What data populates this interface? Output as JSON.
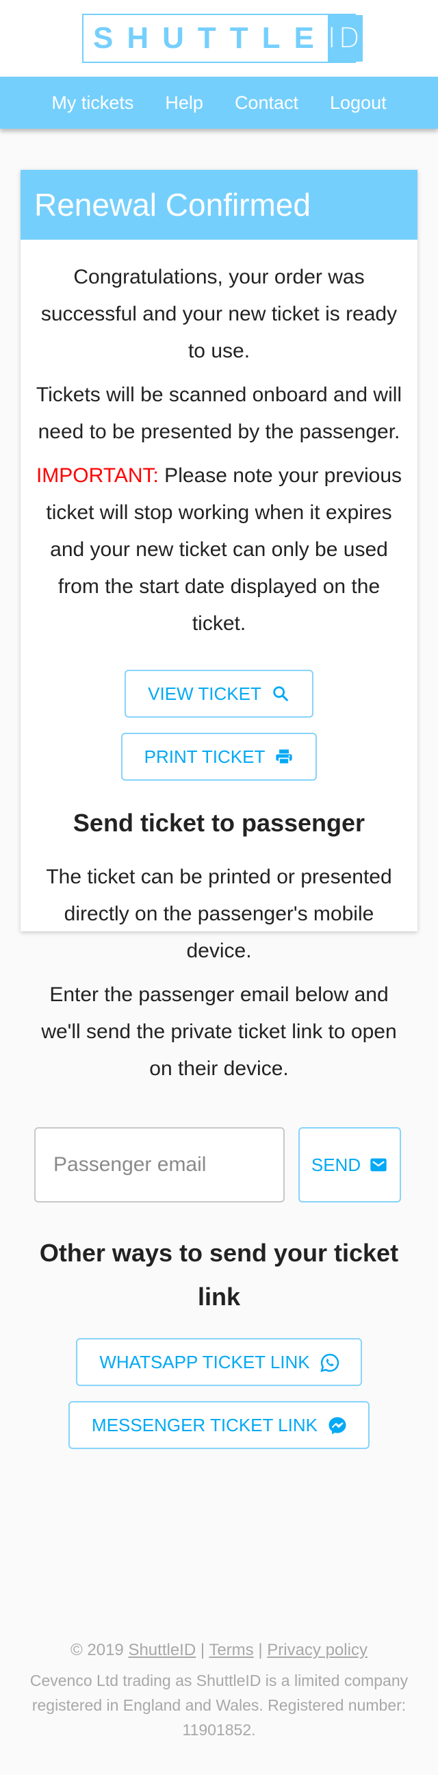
{
  "brand": {
    "logo_word": "SHUTTLE",
    "logo_id": "ID",
    "accent_color": "#75cffc",
    "button_text_color": "#03a9f4",
    "important_color": "#ff0000"
  },
  "nav": {
    "items": [
      {
        "label": "My tickets"
      },
      {
        "label": "Help"
      },
      {
        "label": "Contact"
      },
      {
        "label": "Logout"
      }
    ]
  },
  "card": {
    "title": "Renewal Confirmed",
    "paragraphs": {
      "congrats": "Congratulations, your order was successful and your new ticket is ready to use.",
      "scanned": "Tickets will be scanned onboard and will need to be presented by the passenger.",
      "important_label": "IMPORTANT:",
      "important_text": " Please note your previous ticket will stop working when it expires and your new ticket can only be used from the start date displayed on the ticket."
    },
    "buttons": {
      "view_ticket": {
        "label": "VIEW TICKET",
        "icon": "search-icon"
      },
      "print_ticket": {
        "label": "PRINT TICKET",
        "icon": "printer-icon"
      }
    },
    "send_section": {
      "title": "Send ticket to passenger",
      "para1": "The ticket can be printed or presented directly on the passenger's mobile device.",
      "para2": "Enter the passenger email below and we'll send the private ticket link to open on their device.",
      "email_placeholder": "Passenger email",
      "email_value": "",
      "send_label": "SEND",
      "send_icon": "mail-icon"
    },
    "other_section": {
      "title": "Other ways to send your ticket link",
      "whatsapp_label": "WHATSAPP TICKET LINK",
      "whatsapp_icon": "whatsapp-icon",
      "messenger_label": "MESSENGER TICKET LINK",
      "messenger_icon": "messenger-icon"
    }
  },
  "footer": {
    "copyright": "© 2019",
    "links": {
      "shuttleid": "ShuttleID",
      "terms": "Terms",
      "privacy": "Privacy policy"
    },
    "separator": "|",
    "legal": "Cevenco Ltd trading as ShuttleID is a limited company registered in England and Wales. Registered number: 11901852."
  }
}
